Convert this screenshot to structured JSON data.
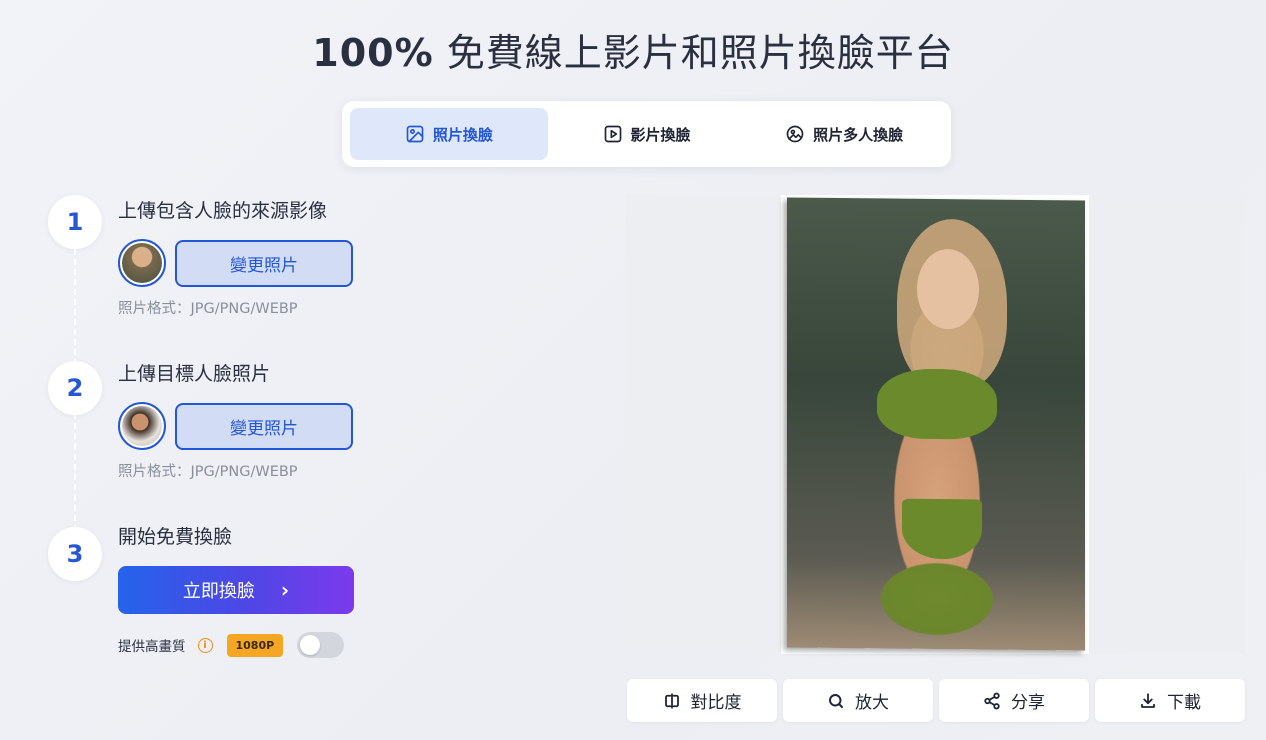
{
  "header": {
    "title_strong": "100%",
    "title_rest": " 免費線上影片和照片換臉平台"
  },
  "tabs": [
    {
      "label": "照片換臉",
      "icon": "image-icon",
      "active": true
    },
    {
      "label": "影片換臉",
      "icon": "play-icon",
      "active": false
    },
    {
      "label": "照片多人換臉",
      "icon": "multi-image-icon",
      "active": false
    }
  ],
  "steps": [
    {
      "number": "1",
      "title": "上傳包含人臉的來源影像",
      "button_label": "變更照片",
      "format_text": "照片格式：JPG/PNG/WEBP"
    },
    {
      "number": "2",
      "title": "上傳目標人臉照片",
      "button_label": "變更照片",
      "format_text": "照片格式：JPG/PNG/WEBP"
    },
    {
      "number": "3",
      "title": "開始免費換臉",
      "button_label": "立即換臉"
    }
  ],
  "hq": {
    "label": "提供高畫質",
    "badge": "1080P",
    "toggle_on": false
  },
  "actions": [
    {
      "label": "對比度",
      "icon": "compare-icon"
    },
    {
      "label": "放大",
      "icon": "search-icon"
    },
    {
      "label": "分享",
      "icon": "share-icon"
    },
    {
      "label": "下載",
      "icon": "download-icon"
    }
  ],
  "colors": {
    "accent": "#2457d6",
    "badge": "#f5a623",
    "info": "#f08a1c",
    "cta_start": "#2563eb",
    "cta_end": "#7c3aed"
  }
}
